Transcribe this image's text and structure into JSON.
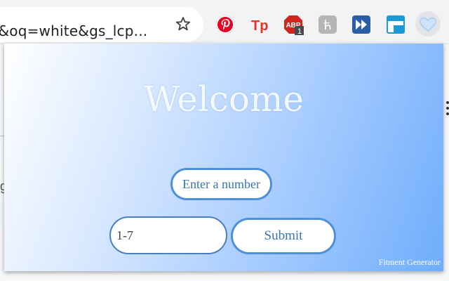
{
  "browser": {
    "omnibox_text": "M&oq=white&gs_lcp...",
    "extensions": [
      {
        "name": "pinterest-icon",
        "color": "#e60023"
      },
      {
        "name": "tp-icon",
        "label": "Tp",
        "color": "#e4322b"
      },
      {
        "name": "adblock-icon",
        "label": "ABP",
        "badge": "1",
        "color": "#d0241c"
      },
      {
        "name": "h-icon",
        "label": "ћ",
        "color": "#b5b5b5"
      },
      {
        "name": "fast-forward-icon",
        "color": "#2a5fa8"
      },
      {
        "name": "window-icon",
        "color": "#1a9ad6"
      },
      {
        "name": "heart-icon",
        "color": "#a8cdf2"
      }
    ]
  },
  "background": {
    "left_letter": "g"
  },
  "popup": {
    "title": "Welcome",
    "label": "Enter a number",
    "input_placeholder": "1-7",
    "input_value": "",
    "submit_label": "Submit",
    "credit": "Fitment Generator",
    "colors": {
      "accent": "#4d8fd8",
      "text": "#3a74b5",
      "gradient_start": "#ffffff",
      "gradient_end": "#6fadfc"
    }
  }
}
